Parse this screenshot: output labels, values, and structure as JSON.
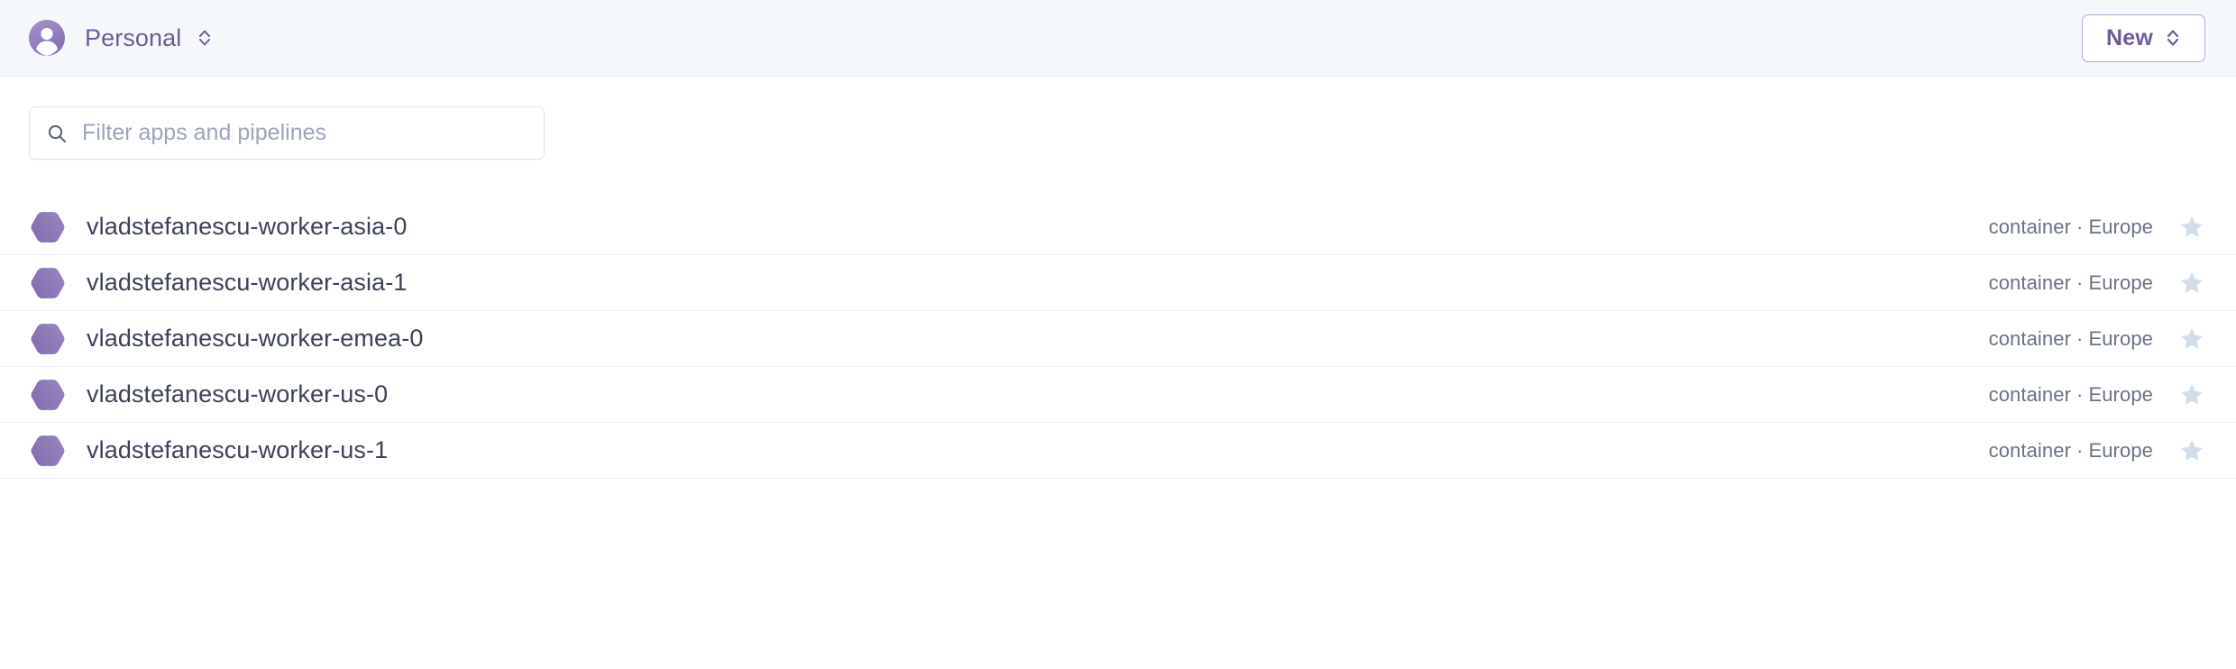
{
  "header": {
    "avatar_icon": "user-avatar-icon",
    "account_name": "Personal",
    "account_selector_icon": "chevron-up-down-icon",
    "new_button": {
      "label": "New",
      "icon": "chevron-up-down-icon"
    },
    "background_color": "#f4f8fb",
    "accent_color": "#6f5a9c"
  },
  "filter": {
    "search_icon": "search-icon",
    "placeholder": "Filter apps and pipelines",
    "value": ""
  },
  "list": {
    "separator": "·",
    "star_icon": "star-icon",
    "row_icon": "hexagon-icon",
    "hexagon_color": "#8d76b6",
    "star_color": "#d3dce8",
    "rows": [
      {
        "name": "vladstefanescu-worker-asia-0",
        "type": "container",
        "region": "Europe",
        "starred": false
      },
      {
        "name": "vladstefanescu-worker-asia-1",
        "type": "container",
        "region": "Europe",
        "starred": false
      },
      {
        "name": "vladstefanescu-worker-emea-0",
        "type": "container",
        "region": "Europe",
        "starred": false
      },
      {
        "name": "vladstefanescu-worker-us-0",
        "type": "container",
        "region": "Europe",
        "starred": false
      },
      {
        "name": "vladstefanescu-worker-us-1",
        "type": "container",
        "region": "Europe",
        "starred": false
      }
    ]
  }
}
